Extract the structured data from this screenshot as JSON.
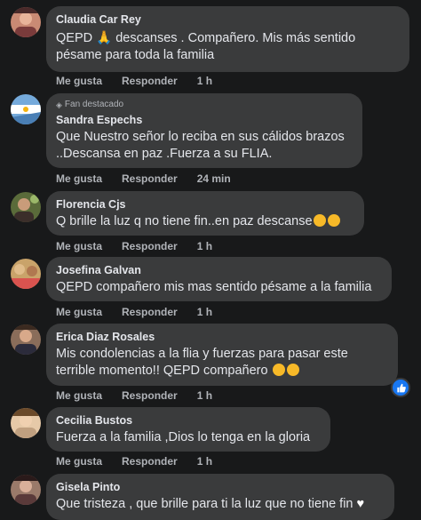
{
  "actions": {
    "like": "Me gusta",
    "reply": "Responder"
  },
  "comments": [
    {
      "author": "Claudia Car Rey",
      "lines": [
        "QEPD 🙏 descanses . Compañero. Mis más sentido",
        "pésame para toda la familia"
      ],
      "time": "1 h"
    },
    {
      "author": "Sandra Espechs",
      "badge": "Fan destacado",
      "lines": [
        "Que Nuestro señor lo reciba en sus cálidos brazos",
        "..Descansa en paz .Fuerza a su FLIA."
      ],
      "time": "24 min"
    },
    {
      "author": "Florencia Cjs",
      "lines": [
        "Q brille la luz q no tiene fin..en paz descanse"
      ],
      "time": "1 h"
    },
    {
      "author": "Josefina Galvan",
      "lines": [
        "QEPD compañero mis mas sentido pésame a la familia"
      ],
      "time": "1 h"
    },
    {
      "author": "Erica Diaz Rosales",
      "lines": [
        "Mis condolencias a la flia y fuerzas para pasar este",
        "terrible momento!! QEPD compañero"
      ],
      "time": "1 h"
    },
    {
      "author": "Cecilia Bustos",
      "lines": [
        "Fuerza a la familia ,Dios lo tenga en la gloria"
      ],
      "time": "1 h"
    },
    {
      "author": "Gisela Pinto",
      "lines": [
        "Que tristeza , que brille para ti la luz que no tiene fin"
      ]
    }
  ],
  "icons": {
    "pray": "folded-hands-emoji",
    "sad": "sad-face-emoji",
    "cry": "crying-face-emoji",
    "heart": "white-heart-emoji",
    "like": "thumbs-up-icon",
    "badge": "diamond-icon"
  },
  "colors": {
    "background": "#18191a",
    "bubble": "#3a3b3c",
    "like": "#1877f2",
    "text": "#e4e6eb",
    "secondary": "#b0b3b8"
  }
}
